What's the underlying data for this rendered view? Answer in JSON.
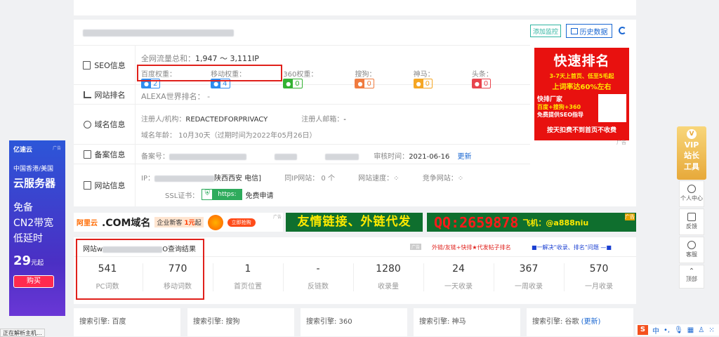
{
  "header": {
    "monitor_btn": "添加监控",
    "history_btn": "历史数据"
  },
  "seo": {
    "label": "SEO信息",
    "traffic_label": "全网流量总和：",
    "traffic_value": "1,947 ～ 3,111IP",
    "weights": [
      {
        "name": "百度权重：",
        "value": "2",
        "color": "#2d8cf0"
      },
      {
        "name": "移动权重：",
        "value": "4",
        "color": "#2d8cf0"
      },
      {
        "name": "360权重：",
        "value": "0",
        "color": "#34b233"
      },
      {
        "name": "搜狗：",
        "value": "0",
        "color": "#f07b3f"
      },
      {
        "name": "神马：",
        "value": "0",
        "color": "#f5a623"
      },
      {
        "name": "头条：",
        "value": "0",
        "color": "#e8454e"
      }
    ]
  },
  "rank": {
    "label": "网站排名",
    "text": "ALEXA世界排名： -"
  },
  "domain": {
    "label": "域名信息",
    "registrant_label": "注册人/机构：",
    "registrant": "REDACTEDFORPRIVACY",
    "email_label": "注册人邮箱：",
    "email": "-",
    "age": "域名年龄：  10月30天（过期时间为2022年05月26日）"
  },
  "icp": {
    "label": "备案信息",
    "no_label": "备案号：",
    "time_label": "审核时间：",
    "time": "2021-06-16",
    "update": "更新"
  },
  "site": {
    "label": "网站信息",
    "ip_label": "IP：",
    "location": "陕西西安 电信]",
    "same_ip": "同IP网站：  0 个",
    "speed": "网站速度：",
    "compete": "竞争网站：",
    "ssl_label": "SSL证书：",
    "ssl_badge": "https:",
    "ssl_apply": "免费申请"
  },
  "ad_right": {
    "title": "快速排名",
    "line1": "3-7天上首页、低至5毛起",
    "line2": "上词率达60%左右",
    "line3": "快排厂家",
    "line4": "百度+搜狗+360",
    "line5": "免费提供SEO指导",
    "bottom": "按天扣费不到首页不收费",
    "tag": "广告"
  },
  "ad_left": {
    "brand": "亿速云",
    "tag": "广告",
    "l1": "中国香港/美国",
    "l2": "云服务器",
    "l3": "免备",
    "l4": "CN2带宽",
    "l5": "低延时",
    "price": "29",
    "unit": "元起",
    "buy": "购买"
  },
  "banners": {
    "aliyun": {
      "brand": "阿里云",
      "text": ".COM域名",
      "sub": "企业新客",
      "price": "1元",
      "sub2": "起",
      "btn": "立即抢购",
      "tag": "广告"
    },
    "friend": {
      "text": "友情链接、外链代发"
    },
    "qq": {
      "text": "QQ:2659878",
      "text2": "飞机：@a888niu",
      "tag": "广告"
    }
  },
  "query": {
    "prefix": "网站w",
    "suffix": "O查询结果",
    "tag": "广告",
    "ad1": "外链/友链+快排★代发帖子排名",
    "ad2": "■一解决“收录、排名”问题 —■"
  },
  "stats": [
    {
      "n": "541",
      "l": "PC词数"
    },
    {
      "n": "770",
      "l": "移动词数"
    },
    {
      "n": "1",
      "l": "首页位置"
    },
    {
      "n": "-",
      "l": "反链数"
    },
    {
      "n": "1280",
      "l": "收录量"
    },
    {
      "n": "24",
      "l": "一天收录"
    },
    {
      "n": "367",
      "l": "一周收录"
    },
    {
      "n": "570",
      "l": "一月收录"
    }
  ],
  "engines": [
    "搜索引擎: 百度",
    "搜索引擎: 搜狗",
    "搜索引擎: 360",
    "搜索引擎: 神马",
    "搜索引擎: 谷歌"
  ],
  "engine_link": "(更新)",
  "right_tools": {
    "vip1": "VIP",
    "vip2": "站长",
    "vip3": "工具",
    "user": "个人中心",
    "feedback": "反馈",
    "service": "客服",
    "top": "顶部"
  },
  "status": "正在解析主机...",
  "ime": "中"
}
